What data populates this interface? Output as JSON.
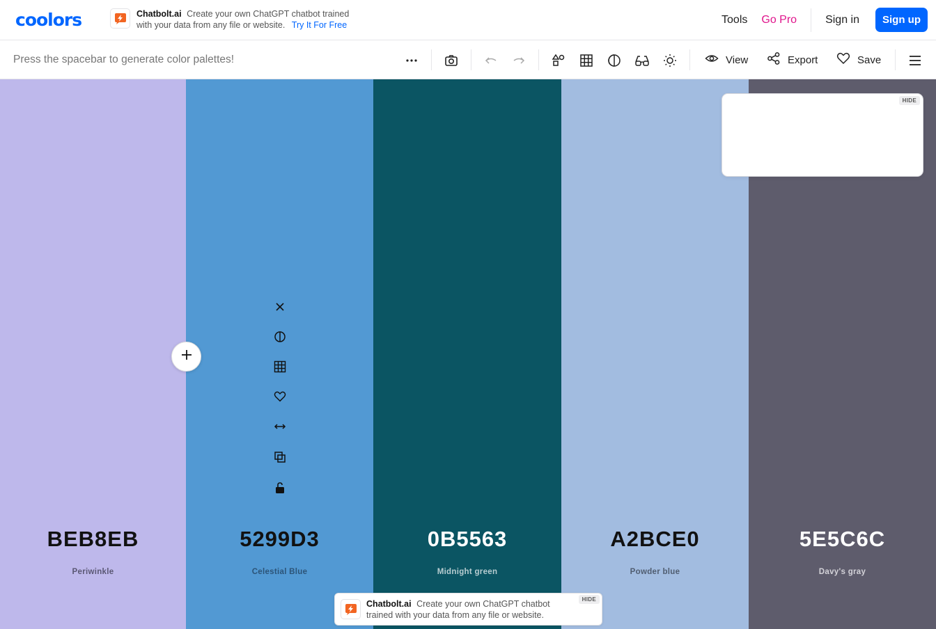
{
  "brand": {
    "logo_text": "coolors",
    "accent": "#0066ff"
  },
  "ad_top": {
    "title": "Chatbolt.ai",
    "text": "Create your own ChatGPT chatbot trained with your data from any file or website.",
    "cta": "Try It For Free",
    "icon": "chatbolt-logo-icon"
  },
  "nav": {
    "tools": "Tools",
    "gopro": "Go Pro",
    "signin": "Sign in",
    "signup": "Sign up"
  },
  "toolbar": {
    "hint": "Press the spacebar to generate color palettes!",
    "view_label": "View",
    "export_label": "Export",
    "save_label": "Save",
    "icons": [
      "more-icon",
      "camera-icon",
      "undo-icon",
      "redo-icon",
      "shapes-icon",
      "grid-icon",
      "contrast-icon",
      "glasses-icon",
      "sun-icon",
      "eye-icon",
      "share-icon",
      "heart-icon",
      "menu-icon"
    ]
  },
  "palette": {
    "swatches": [
      {
        "hex": "BEB8EB",
        "name": "Periwinkle",
        "color": "#BEB8EB",
        "text_color": "#111111",
        "name_color": "#5b5874"
      },
      {
        "hex": "5299D3",
        "name": "Celestial Blue",
        "color": "#5299D3",
        "text_color": "#111111",
        "name_color": "#2c5478"
      },
      {
        "hex": "0B5563",
        "name": "Midnight green",
        "color": "#0B5563",
        "text_color": "#ffffff",
        "name_color": "#b8cdd1"
      },
      {
        "hex": "A2BCE0",
        "name": "Powder blue",
        "color": "#A2BCE0",
        "text_color": "#111111",
        "name_color": "#505d70"
      },
      {
        "hex": "5E5C6C",
        "name": "Davy's gray",
        "color": "#5E5C6C",
        "text_color": "#ffffff",
        "name_color": "#d3d2d8"
      }
    ],
    "swatch_tools": [
      "close-icon",
      "contrast-icon",
      "grid-icon",
      "heart-icon",
      "drag-arrows-icon",
      "copy-icon",
      "lock-open-icon"
    ]
  },
  "ad_box": {
    "hide": "HIDE"
  },
  "ad_bottom": {
    "title": "Chatbolt.ai",
    "text": "Create your own ChatGPT chatbot trained with your data from any file or website.",
    "hide": "HIDE"
  }
}
